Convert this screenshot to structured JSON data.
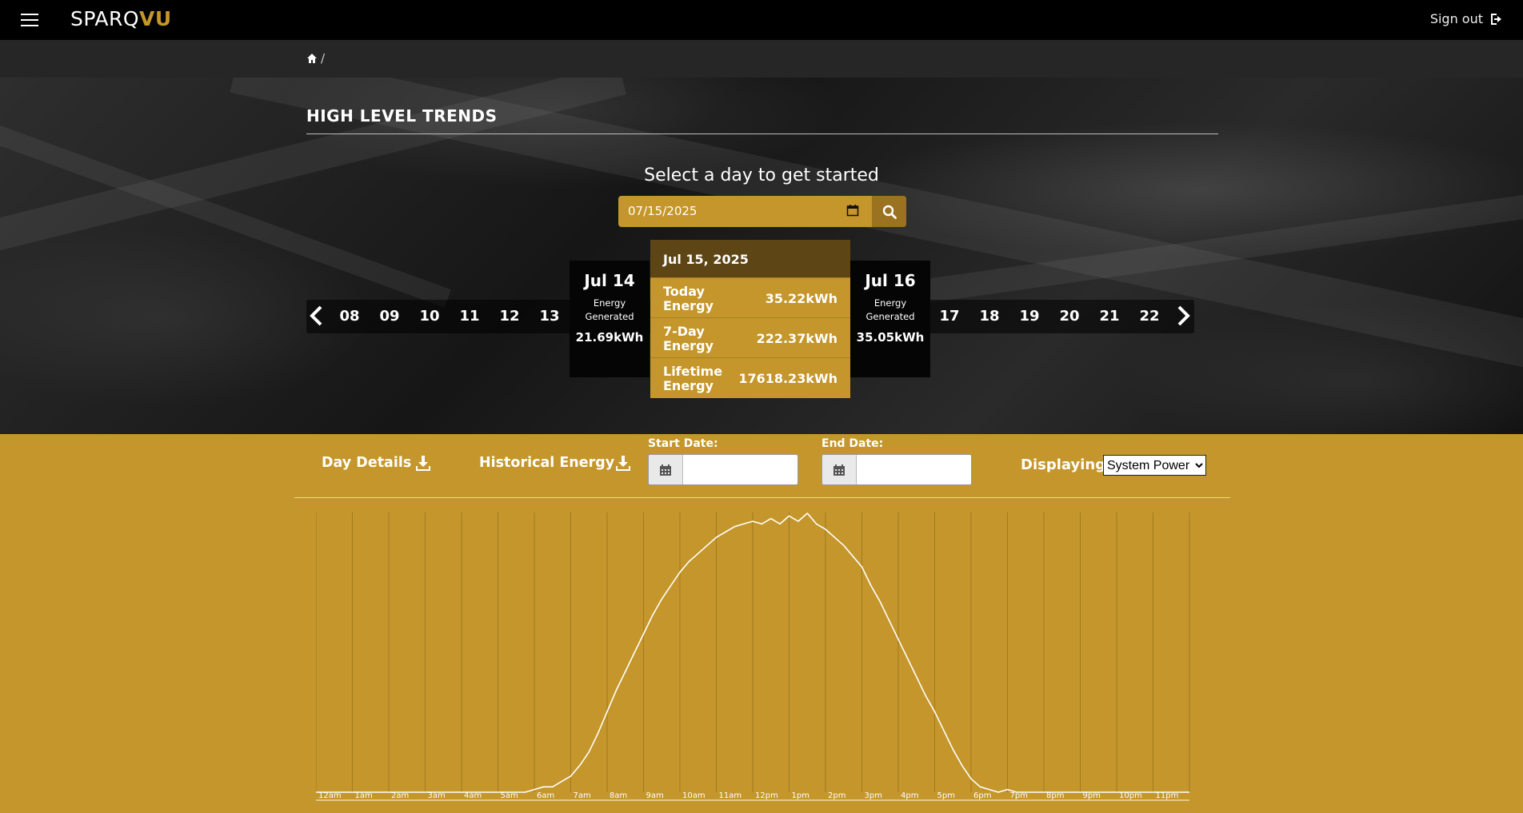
{
  "header": {
    "logo_part1": "SPARQ",
    "logo_part2": "VU",
    "signout_label": "Sign out"
  },
  "breadcrumb": {
    "separator": "/"
  },
  "hero": {
    "title": "HIGH LEVEL TRENDS",
    "subtitle": "Select a day to get started",
    "date_value": "07/15/2025"
  },
  "days_left": [
    "08",
    "09",
    "10",
    "11",
    "12",
    "13"
  ],
  "days_right": [
    "17",
    "18",
    "19",
    "20",
    "21",
    "22"
  ],
  "prev_card": {
    "date": "Jul 14",
    "label_line1": "Energy",
    "label_line2": "Generated",
    "value": "21.69kWh"
  },
  "next_card": {
    "date": "Jul 16",
    "label_line1": "Energy",
    "label_line2": "Generated",
    "value": "35.05kWh"
  },
  "selected": {
    "date": "Jul 15, 2025",
    "rows": [
      {
        "label": "Today Energy",
        "value": "35.22kWh"
      },
      {
        "label": "7-Day Energy",
        "value": "222.37kWh"
      },
      {
        "label": "Lifetime Energy",
        "value": "17618.23kWh"
      }
    ]
  },
  "toolbar": {
    "day_details": "Day Details",
    "historical_energy": "Historical Energy",
    "start_date_label": "Start Date:",
    "end_date_label": "End Date:",
    "displaying_label": "Displaying:",
    "display_options": [
      "System Power"
    ],
    "display_selected": "System Power"
  },
  "colors": {
    "accent": "#c4962b",
    "dark": "#000000"
  },
  "chart_data": {
    "type": "line",
    "x": [
      "12am",
      "1am",
      "2am",
      "3am",
      "4am",
      "5am",
      "6am",
      "7am",
      "8am",
      "9am",
      "10am",
      "11am",
      "12pm",
      "1pm",
      "2pm",
      "3pm",
      "4pm",
      "5pm",
      "6pm",
      "7pm",
      "8pm",
      "9pm",
      "10pm",
      "11pm"
    ],
    "hours": [
      0,
      5.5,
      5.75,
      6,
      6.25,
      6.5,
      6.75,
      7,
      7.25,
      7.5,
      7.75,
      8,
      8.25,
      8.5,
      8.75,
      9,
      9.25,
      9.5,
      9.75,
      10,
      10.25,
      10.5,
      10.75,
      11,
      11.25,
      11.5,
      11.75,
      12,
      12.25,
      12.5,
      12.75,
      13,
      13.25,
      13.5,
      13.75,
      14,
      14.25,
      14.5,
      14.75,
      15,
      15.25,
      15.5,
      15.75,
      16,
      16.25,
      16.5,
      16.75,
      17,
      17.25,
      17.5,
      17.75,
      18,
      18.25,
      18.5,
      18.75,
      19,
      19.25,
      19.5,
      19.75,
      20,
      20.25,
      20.5,
      24
    ],
    "values": [
      0,
      0,
      0,
      0.01,
      0.02,
      0.02,
      0.04,
      0.06,
      0.1,
      0.15,
      0.22,
      0.3,
      0.38,
      0.45,
      0.52,
      0.59,
      0.66,
      0.72,
      0.77,
      0.82,
      0.86,
      0.89,
      0.92,
      0.95,
      0.97,
      0.99,
      1.0,
      1.01,
      1.0,
      1.02,
      1.0,
      1.03,
      1.01,
      1.04,
      1.0,
      0.98,
      0.95,
      0.92,
      0.88,
      0.84,
      0.77,
      0.71,
      0.64,
      0.57,
      0.5,
      0.43,
      0.36,
      0.3,
      0.23,
      0.16,
      0.1,
      0.05,
      0.02,
      0.01,
      0,
      0.01,
      0,
      0,
      0,
      0,
      0,
      0,
      0
    ],
    "xlabel": "",
    "ylabel": "",
    "grid": true,
    "series": [
      {
        "values_ref": "values"
      }
    ]
  }
}
